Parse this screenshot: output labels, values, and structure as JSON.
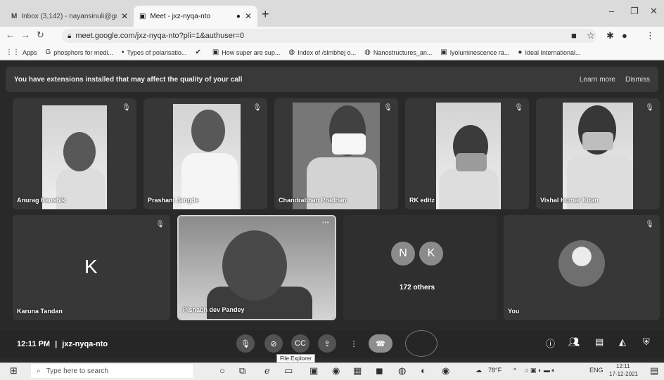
{
  "browser": {
    "tabs": [
      {
        "title": "Inbox (3,142) - nayansinuli@gm",
        "icon": "gmail-icon"
      },
      {
        "title": "Meet - jxz-nyqa-nto",
        "icon": "meet-icon"
      }
    ],
    "url": "meet.google.com/jxz-nyqa-nto?pli=1&authuser=0",
    "bookmarks": [
      {
        "label": "Apps",
        "icon": "apps-grid-icon"
      },
      {
        "label": "phosphors for medi...",
        "icon": "google-icon"
      },
      {
        "label": "Types of polarisatio...",
        "icon": "page-icon"
      },
      {
        "label": "",
        "icon": "check-icon"
      },
      {
        "label": "How super are sup...",
        "icon": "page-icon"
      },
      {
        "label": "Index of /slmbhej o...",
        "icon": "globe-icon"
      },
      {
        "label": "Nanostructures_an...",
        "icon": "globe-icon"
      },
      {
        "label": "lyoluminescence ra...",
        "icon": "page-icon"
      },
      {
        "label": "Ideal International...",
        "icon": "globe-icon"
      }
    ]
  },
  "meet": {
    "banner": {
      "text": "You have extensions installed that may affect the quality of your call",
      "learn_more": "Learn more",
      "dismiss": "Dismiss"
    },
    "participants": [
      {
        "name": "Anurag Kaushik"
      },
      {
        "name": "Prashant Jangde"
      },
      {
        "name": "Chandrabhan Pradhan"
      },
      {
        "name": "RK editz"
      },
      {
        "name": "Vishal Kumar Kiran"
      },
      {
        "name": "Karuna Tandan",
        "initial": "K"
      },
      {
        "name": "Pishabh dev Pandey"
      },
      {
        "name": "You"
      }
    ],
    "others": {
      "initials": [
        "N",
        "K"
      ],
      "label": "172 others"
    },
    "time": "12:11 PM",
    "separator": "|",
    "meeting_code": "jxz-nyqa-nto",
    "tooltip": "File Explorer"
  },
  "taskbar": {
    "search_placeholder": "Type here to search",
    "weather": "78°F",
    "language": "ENG",
    "clock_time": "12:11",
    "clock_date": "17-12-2021"
  }
}
